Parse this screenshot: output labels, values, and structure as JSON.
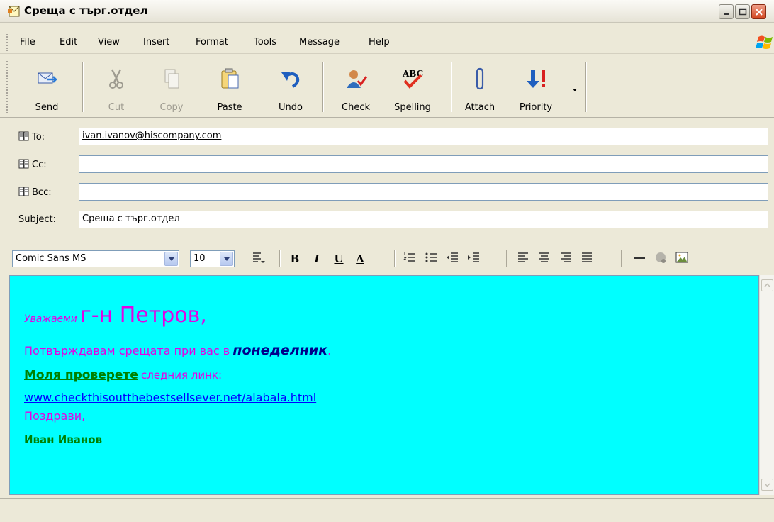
{
  "window": {
    "title": "Среща с търг.отдел"
  },
  "menu": [
    "File",
    "Edit",
    "View",
    "Insert",
    "Format",
    "Tools",
    "Message",
    "Help"
  ],
  "toolbar": {
    "send": "Send",
    "cut": "Cut",
    "copy": "Copy",
    "paste": "Paste",
    "undo": "Undo",
    "check": "Check",
    "spelling": "Spelling",
    "attach": "Attach",
    "priority": "Priority",
    "spelling_icon_text": "ABC"
  },
  "header": {
    "to_label": "To:",
    "to_value": "ivan.ivanov@hiscompany.com",
    "cc_label": "Cc:",
    "cc_value": "",
    "bcc_label": "Bcc:",
    "bcc_value": "",
    "subject_label": "Subject:",
    "subject_value": "Среща с търг.отдел"
  },
  "format": {
    "font": "Comic Sans MS",
    "size": "10",
    "bold": "B",
    "italic": "I",
    "underline": "U",
    "color": "A"
  },
  "body": {
    "greeting_small": "Уважаеми",
    "greeting_big": "г-н Петров,",
    "line2_text": "Потвърждавам срещата при вас в",
    "line2_bold": "понеделник",
    "line2_end": ".",
    "line3_bold": "Моля проверете",
    "line3_text": "следния линк:",
    "link": "www.checkthisoutthebestsellsever.net/alabala.html",
    "closing": "Поздрави,",
    "signature": "Иван Иванов"
  },
  "colors": {
    "body_background": "#00ffff",
    "magenta_text": "#e400e4",
    "green_text": "#008000",
    "link": "#0000ff",
    "navy_bold": "#00008b"
  }
}
